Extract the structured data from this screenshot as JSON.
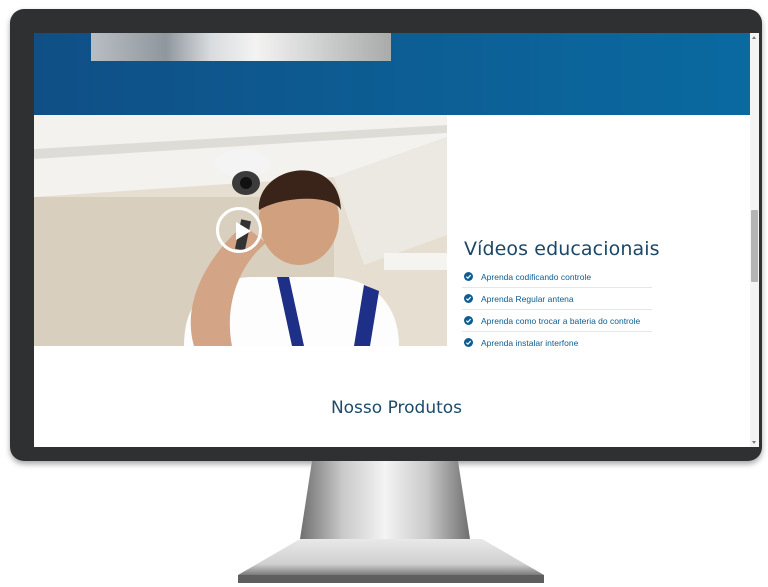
{
  "video_section": {
    "title": "Vídeos educacionais",
    "items": [
      {
        "label": "Aprenda codificando controle"
      },
      {
        "label": "Aprenda Regular antena"
      },
      {
        "label": "Aprenda como trocar a bateria do controle"
      },
      {
        "label": "Aprenda instalar interfone"
      }
    ]
  },
  "products_section": {
    "title": "Nosso Produtos"
  },
  "colors": {
    "brand_blue": "#0c5f95",
    "title_text": "#1d4766",
    "link_text": "#0d5d92",
    "monitor_bezel": "#2f3031"
  },
  "icons": {
    "list_bullet": "check-circle-icon",
    "video_overlay": "play-icon"
  }
}
